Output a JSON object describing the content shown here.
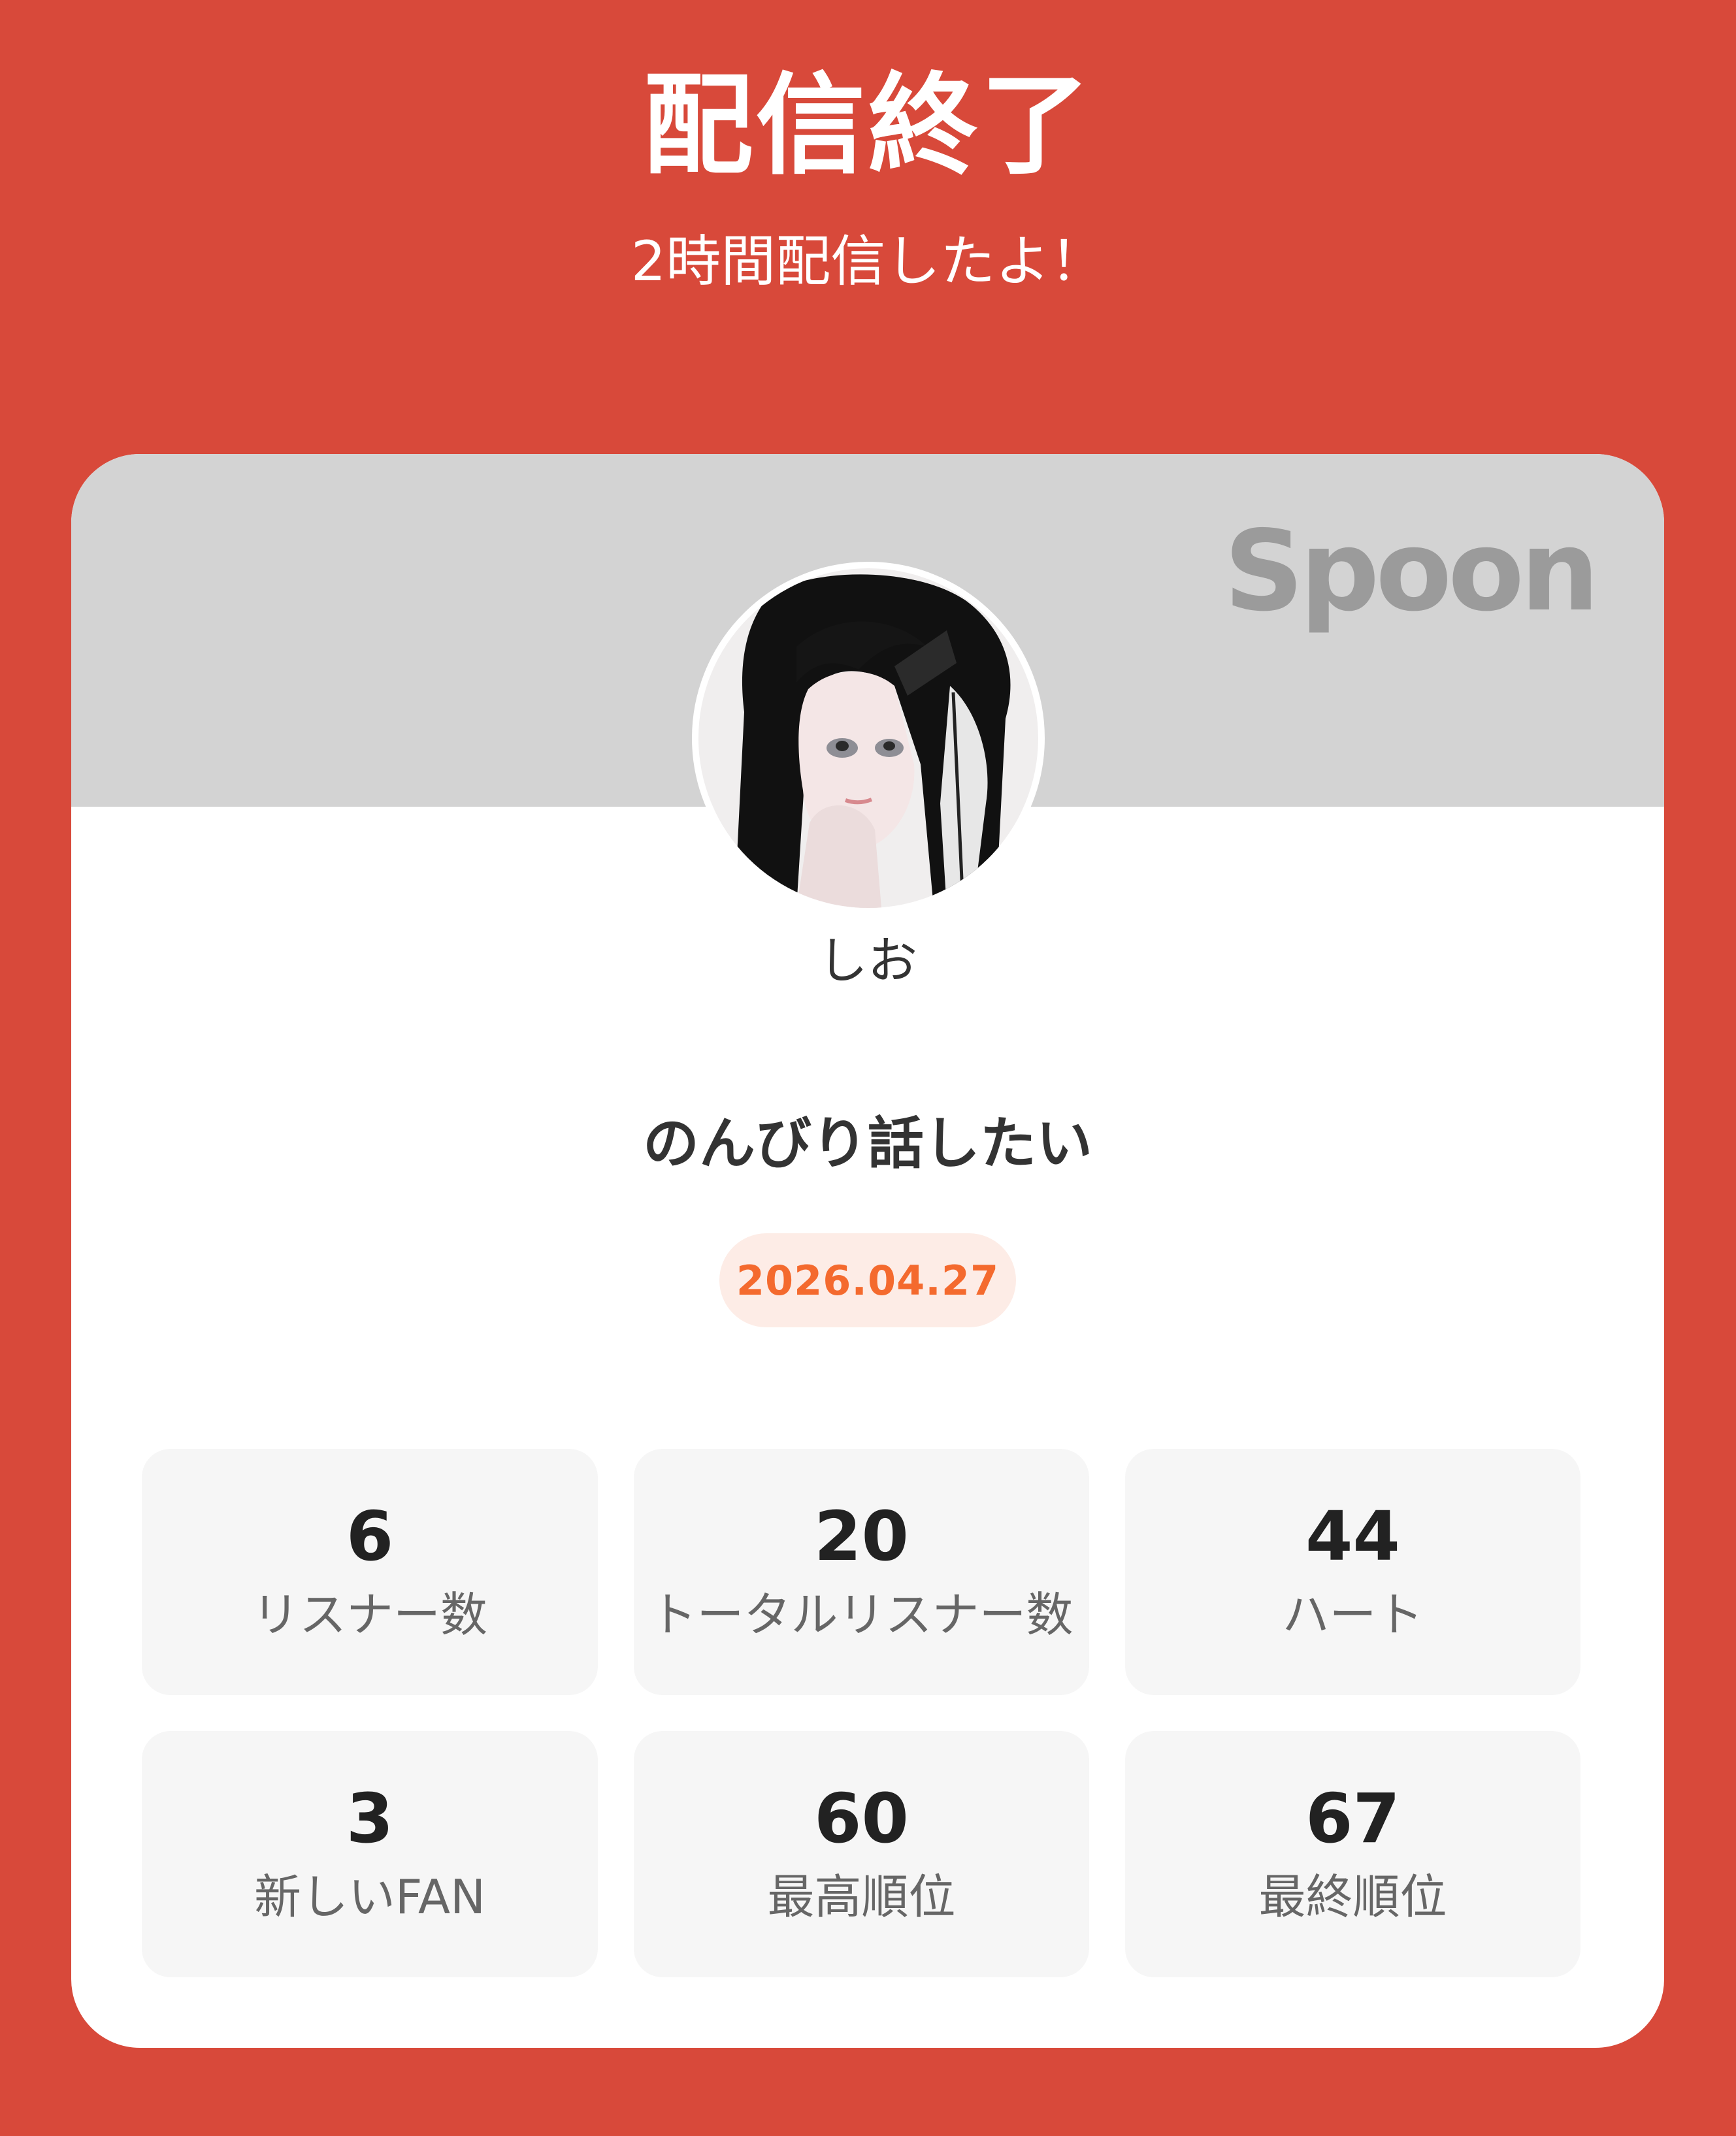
{
  "header": {
    "title": "配信終了",
    "subtitle": "2時間配信したよ！"
  },
  "card": {
    "brand": "Spoon",
    "username": "しお",
    "stream_title": "のんびり話したい",
    "date": "2026.04.27"
  },
  "stats": [
    {
      "value": "6",
      "label": "リスナー数"
    },
    {
      "value": "20",
      "label": "トータルリスナー数"
    },
    {
      "value": "44",
      "label": "ハート"
    },
    {
      "value": "3",
      "label": "新しいFAN"
    },
    {
      "value": "60",
      "label": "最高順位"
    },
    {
      "value": "67",
      "label": "最終順位"
    }
  ],
  "colors": {
    "background": "#D8493A",
    "banner": "#D3D3D3",
    "logo": "#9B9B9B",
    "date_text": "#F46A2E",
    "date_badge": "#FDECE6",
    "stat_card": "#F6F6F6"
  }
}
